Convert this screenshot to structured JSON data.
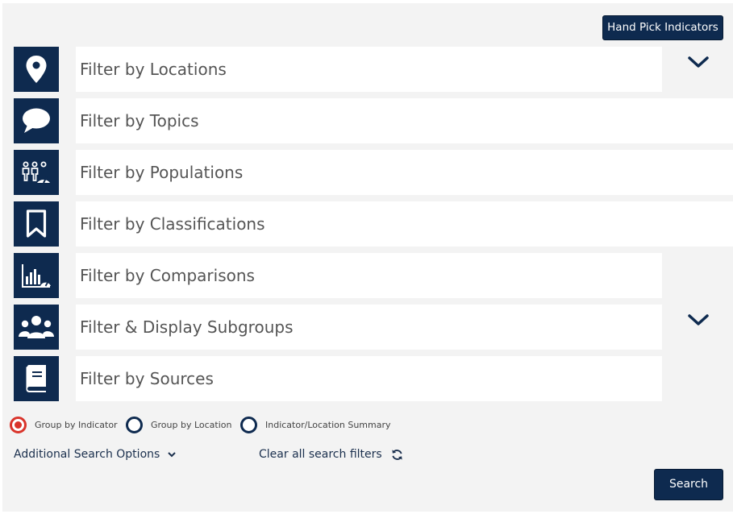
{
  "header": {
    "hand_pick_label": "Hand Pick Indicators"
  },
  "filters": [
    {
      "label": "Filter by Locations",
      "icon": "location-pin-icon"
    },
    {
      "label": "Filter by Topics",
      "icon": "speech-bubble-icon"
    },
    {
      "label": "Filter by Populations",
      "icon": "population-icon"
    },
    {
      "label": "Filter by Classifications",
      "icon": "bookmark-icon"
    },
    {
      "label": "Filter by Comparisons",
      "icon": "comparison-chart-icon"
    },
    {
      "label": "Filter & Display Subgroups",
      "icon": "group-users-icon"
    },
    {
      "label": "Filter by Sources",
      "icon": "book-icon"
    }
  ],
  "grouping": {
    "options": [
      {
        "label": "Group by Indicator",
        "selected": true
      },
      {
        "label": "Group by Location",
        "selected": false
      },
      {
        "label": "Indicator/Location Summary",
        "selected": false
      }
    ]
  },
  "footer": {
    "additional_options_label": "Additional Search Options",
    "clear_filters_label": "Clear all search filters",
    "search_label": "Search"
  },
  "colors": {
    "primary": "#0e2a4f",
    "selected_radio": "#d9342b",
    "panel_background": "#f3f3f3"
  }
}
